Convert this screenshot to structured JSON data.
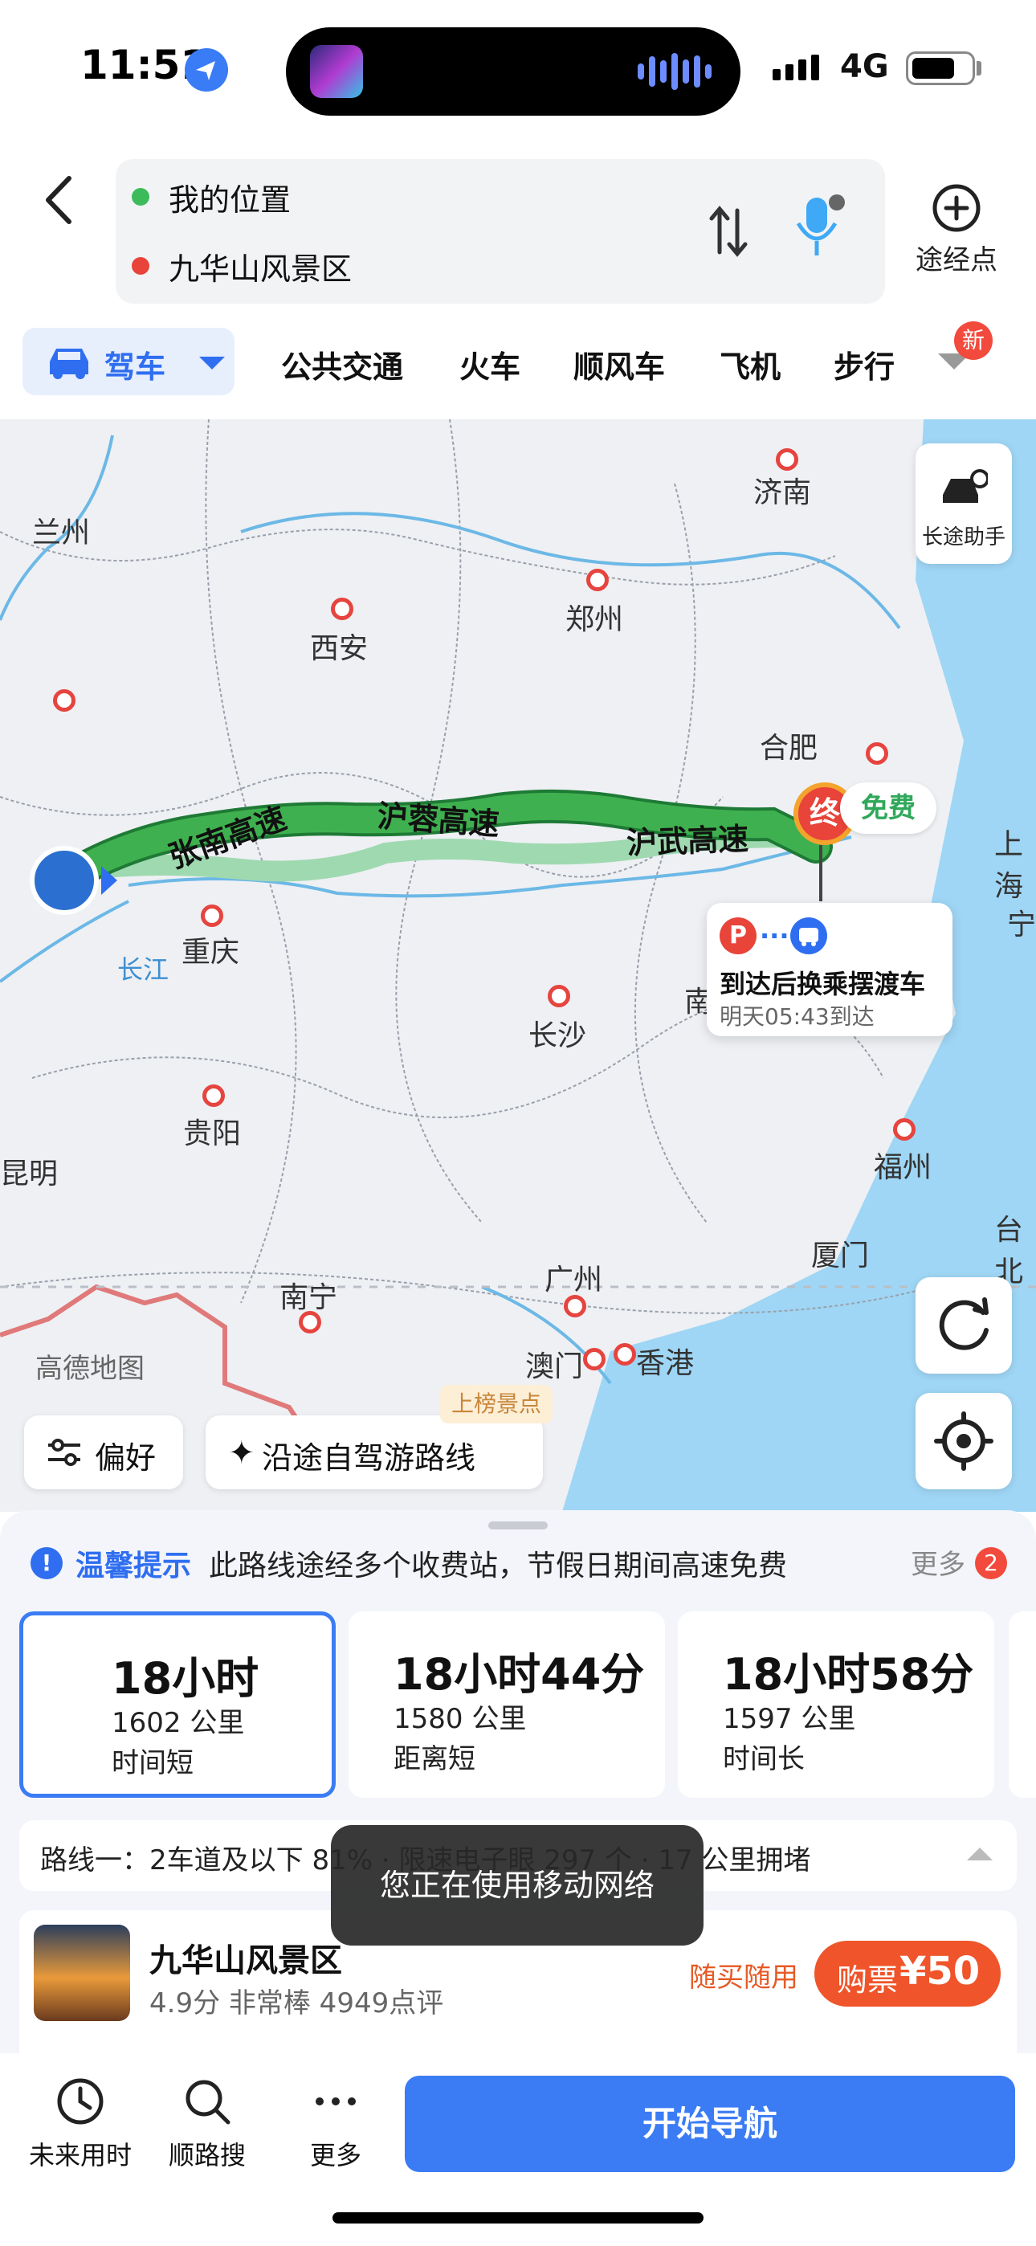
{
  "status_bar": {
    "time": "11:51",
    "network": "4G"
  },
  "route_input": {
    "origin": "我的位置",
    "destination": "九华山风景区",
    "waypoint_label": "途经点"
  },
  "modes": {
    "active": "驾车",
    "tabs": [
      "公共交通",
      "火车",
      "顺风车",
      "飞机",
      "步行"
    ],
    "new_badge": "新"
  },
  "map": {
    "cities": [
      "兰州",
      "济南",
      "西安",
      "郑州",
      "合肥",
      "上海",
      "重庆",
      "长沙",
      "南",
      "宁",
      "贵阳",
      "昆明",
      "福州",
      "台北",
      "厦门",
      "广州",
      "南宁",
      "澳门",
      "香港"
    ],
    "roads": [
      "张南高速",
      "沪蓉高速",
      "沪武高速"
    ],
    "river": "长江",
    "longtrip_label": "长途助手",
    "end_marker": "终",
    "free_badge": "免费",
    "shuttle": {
      "title": "到达后换乘摆渡车",
      "eta": "明天05:43到达",
      "parking": "P",
      "dots": "..."
    },
    "logo": "高德地图",
    "preference_label": "偏好",
    "scenic_label": "沿途自驾游路线",
    "scenic_badge": "上榜景点"
  },
  "tip": {
    "title": "温馨提示",
    "text": "此路线途经多个收费站，节假日期间高速免费",
    "more": "更多",
    "count": "2"
  },
  "routes": [
    {
      "time": "18小时",
      "distance": "1602 公里",
      "tag": "时间短"
    },
    {
      "time": "18小时44分",
      "distance": "1580 公里",
      "tag": "距离短"
    },
    {
      "time": "18小时58分",
      "distance": "1597 公里",
      "tag": "时间长"
    }
  ],
  "route_detail": "路线一：2车道及以下 81% · 限速电子眼 297 个 · 17 公里拥堵",
  "toast": "您正在使用移动网络",
  "poi": {
    "name": "九华山风景区",
    "meta": "4.9分  非常棒  4949点评",
    "buy_note": "随买随用",
    "buy_label": "购票",
    "price": "¥50"
  },
  "bottom_bar": {
    "future_label": "未来用时",
    "search_label": "顺路搜",
    "more_label": "更多",
    "nav_label": "开始导航"
  },
  "colors": {
    "accent": "#3b7cf4",
    "route_green": "#3fb04f",
    "danger": "#e8443a",
    "buy_orange": "#f0542a"
  }
}
